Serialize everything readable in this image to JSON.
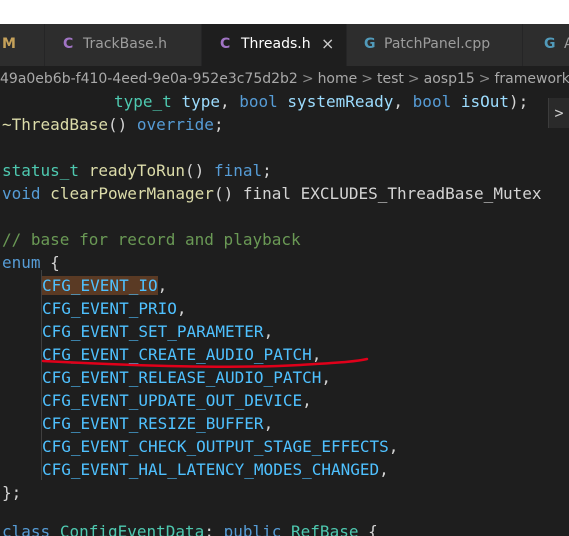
{
  "tabs": [
    {
      "icon": "M",
      "label": ""
    },
    {
      "icon": "C",
      "label": "TrackBase.h"
    },
    {
      "icon": "C",
      "label": "Threads.h",
      "close": "×"
    },
    {
      "icon": "G",
      "label": "PatchPanel.cpp"
    },
    {
      "icon": "G",
      "label": "A"
    }
  ],
  "breadcrumb": {
    "segments": [
      "49a0eb6b-f410-4eed-9e0a-952e3c75d2b2",
      "home",
      "test",
      "aosp15",
      "frameworks"
    ],
    "separator": ">"
  },
  "peek_button": ">",
  "code": {
    "line1": {
      "type_t": "type_t",
      "type": "type",
      "comma1": ",",
      "bool1": "bool",
      "systemReady": "systemReady",
      "comma2": ",",
      "bool2": "bool",
      "isOut": "isOut",
      "end": ");"
    },
    "line2": {
      "dtor": "~ThreadBase",
      "parens": "()",
      "override": "override",
      "semi": ";"
    },
    "line3": {
      "status_t": "status_t",
      "fn": "readyToRun",
      "parens": "()",
      "final": "final",
      "semi": ";"
    },
    "line4": {
      "void": "void",
      "fn": "clearPowerManager",
      "parens": "()",
      "final": "final",
      "rest": "EXCLUDES_ThreadBase_Mutex"
    },
    "comment": "// base for record and playback",
    "enum_kw": "enum",
    "enum_open": "{",
    "enumerators": [
      "CFG_EVENT_IO",
      "CFG_EVENT_PRIO",
      "CFG_EVENT_SET_PARAMETER",
      "CFG_EVENT_CREATE_AUDIO_PATCH",
      "CFG_EVENT_RELEASE_AUDIO_PATCH",
      "CFG_EVENT_UPDATE_OUT_DEVICE",
      "CFG_EVENT_RESIZE_BUFFER",
      "CFG_EVENT_CHECK_OUTPUT_STAGE_EFFECTS",
      "CFG_EVENT_HAL_LATENCY_MODES_CHANGED"
    ],
    "enumerator_sep": ",",
    "enum_close": "};",
    "last": {
      "class_kw": "class",
      "name": "ConfigEventData",
      "colon": ":",
      "public_kw": "public",
      "base": "RefBase",
      "brace": "{"
    }
  },
  "colors": {
    "editor_bg": "#1e1e1e",
    "tab_active_bg": "#1e1e1e",
    "tab_inactive_bg": "#2d2d2d",
    "c_icon": "#a074c4",
    "cpp_icon": "#519aba",
    "annotation_red": "#e0001a"
  }
}
